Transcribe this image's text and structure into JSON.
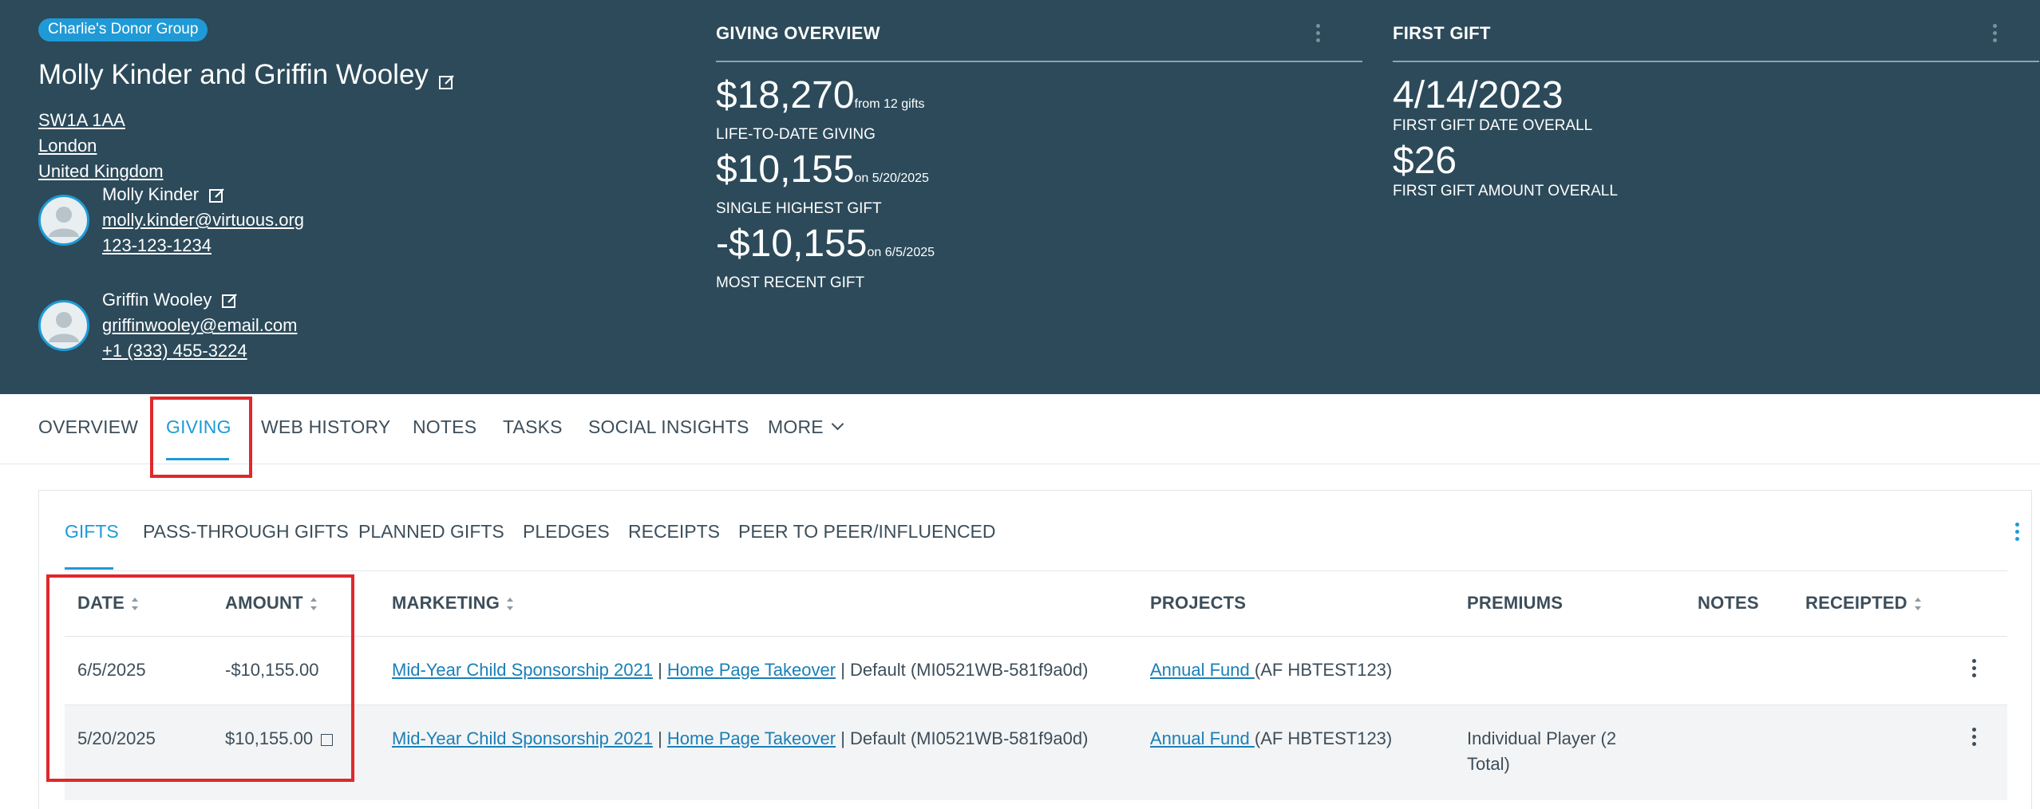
{
  "header": {
    "group_badge": "Charlie's Donor Group",
    "donor_name": "Molly Kinder and Griffin Wooley",
    "address": [
      "SW1A 1AA",
      "London",
      "United Kingdom"
    ],
    "contacts": [
      {
        "name": "Molly Kinder",
        "email": "molly.kinder@virtuous.org",
        "phone": "123-123-1234"
      },
      {
        "name": "Griffin Wooley",
        "email": "griffinwooley@email.com",
        "phone": "+1 (333) 455-3224"
      }
    ]
  },
  "giving_overview": {
    "title": "GIVING OVERVIEW",
    "stats": [
      {
        "value": "$18,270",
        "suffix": "from 12 gifts",
        "label": "LIFE-TO-DATE GIVING"
      },
      {
        "value": "$10,155",
        "suffix": "on 5/20/2025",
        "label": "SINGLE HIGHEST GIFT"
      },
      {
        "value": "-$10,155",
        "suffix": "on 6/5/2025",
        "label": "MOST RECENT GIFT"
      }
    ]
  },
  "first_gift": {
    "title": "FIRST GIFT",
    "stats": [
      {
        "value": "4/14/2023",
        "label": "FIRST GIFT DATE OVERALL"
      },
      {
        "value": "$26",
        "label": "FIRST GIFT AMOUNT OVERALL"
      }
    ]
  },
  "main_tabs": [
    "OVERVIEW",
    "GIVING",
    "WEB HISTORY",
    "NOTES",
    "TASKS",
    "SOCIAL INSIGHTS",
    "MORE"
  ],
  "sub_tabs": [
    "GIFTS",
    "PASS-THROUGH GIFTS",
    "PLANNED GIFTS",
    "PLEDGES",
    "RECEIPTS",
    "PEER TO PEER/INFLUENCED"
  ],
  "table": {
    "columns": [
      "DATE",
      "AMOUNT",
      "MARKETING",
      "PROJECTS",
      "PREMIUMS",
      "NOTES",
      "RECEIPTED"
    ],
    "rows": [
      {
        "date": "6/5/2025",
        "amount": "-$10,155.00",
        "marketing_link1": "Mid-Year Child Sponsorship 2021",
        "sep1": " | ",
        "marketing_link2": "Home Page Takeover",
        "marketing_rest": " | Default (MI0521WB-581f9a0d)",
        "project_link": "Annual Fund ",
        "project_code": "(AF HBTEST123)",
        "premiums": ""
      },
      {
        "date": "5/20/2025",
        "amount": "$10,155.00",
        "marketing_link1": "Mid-Year Child Sponsorship 2021",
        "sep1": " | ",
        "marketing_link2": "Home Page Takeover",
        "marketing_rest": " | Default (MI0521WB-581f9a0d)",
        "project_link": "Annual Fund ",
        "project_code": "(AF HBTEST123)",
        "premiums": "Individual Player (2 Total)"
      }
    ]
  },
  "colors": {
    "header_bg": "#2c4a5a",
    "accent": "#1f9ad6",
    "highlight_border": "#e0282b"
  }
}
